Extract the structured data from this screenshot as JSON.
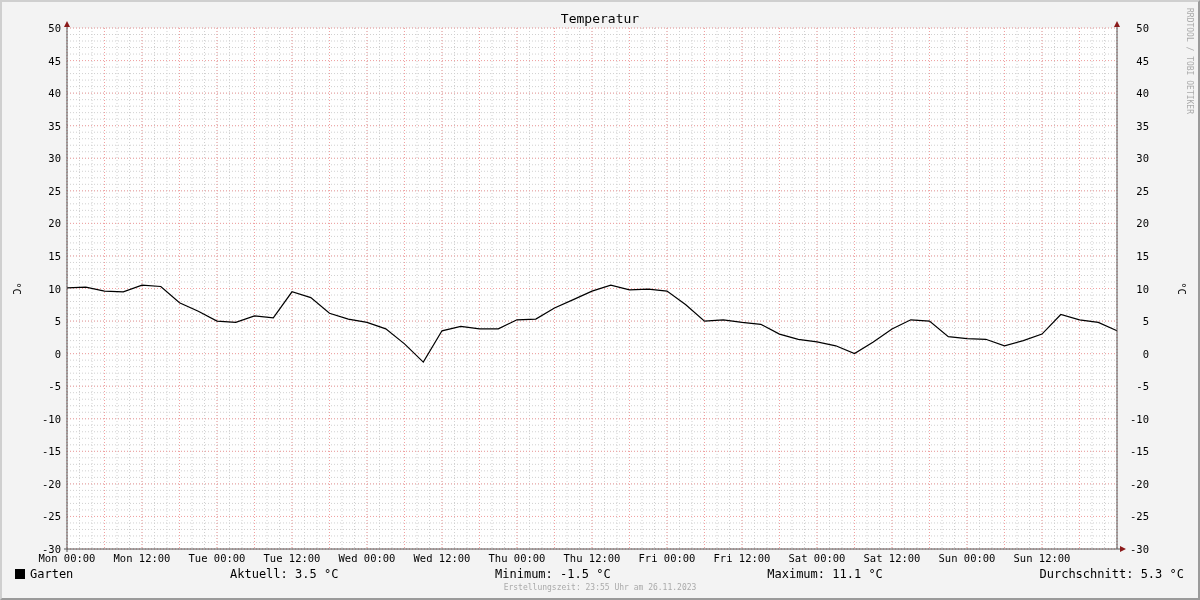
{
  "graph": {
    "watermark": "RRDTOOL / TOBI OETIKER",
    "right_ylabel": "°C",
    "right_yticks": [
      "50",
      "45",
      "40",
      "35",
      "30",
      "25",
      "20",
      "15",
      "10",
      "5",
      "0",
      "-5",
      "-10",
      "-15",
      "-20",
      "-25",
      "-30"
    ],
    "chart_data": {
      "type": "line",
      "title": "Temperatur",
      "ylabel": "°C",
      "categories": [
        "Mon 00:00",
        null,
        null,
        null,
        "Mon 12:00",
        null,
        null,
        null,
        "Tue 00:00",
        null,
        null,
        null,
        "Tue 12:00",
        null,
        null,
        null,
        "Wed 00:00",
        null,
        null,
        null,
        "Wed 12:00",
        null,
        null,
        null,
        "Thu 00:00",
        null,
        null,
        null,
        "Thu 12:00",
        null,
        null,
        null,
        "Fri 00:00",
        null,
        null,
        null,
        "Fri 12:00",
        null,
        null,
        null,
        "Sat 00:00",
        null,
        null,
        null,
        "Sat 12:00",
        null,
        null,
        null,
        "Sun 00:00",
        null,
        null,
        null,
        "Sun 12:00",
        null,
        null,
        null,
        null
      ],
      "series": [
        {
          "name": "Garten",
          "color": "#000000",
          "values": [
            10.1,
            10.2,
            9.6,
            9.5,
            10.5,
            10.3,
            7.8,
            6.5,
            5.0,
            4.8,
            5.8,
            5.5,
            9.5,
            8.6,
            6.2,
            5.3,
            4.8,
            3.8,
            1.5,
            -1.3,
            3.5,
            4.2,
            3.8,
            3.8,
            5.2,
            5.3,
            7.0,
            8.3,
            9.6,
            10.5,
            9.8,
            9.9,
            9.6,
            7.5,
            5.0,
            5.2,
            4.8,
            4.5,
            3.0,
            2.2,
            1.8,
            1.2,
            0.0,
            1.8,
            3.8,
            5.2,
            5.0,
            2.6,
            2.3,
            2.2,
            1.2,
            2.0,
            3.0,
            6.0,
            5.2,
            4.8,
            3.5
          ]
        }
      ],
      "ylim": [
        -30,
        50
      ],
      "grid": true,
      "yticks": [
        50,
        45,
        40,
        35,
        30,
        25,
        20,
        15,
        10,
        5,
        0,
        -5,
        -10,
        -15,
        -20,
        -25,
        -30
      ]
    }
  },
  "legend": {
    "stats": [
      "Aktuell: 3.5 °C",
      "Minimum: -1.5 °C",
      "Maximum: 11.1 °C",
      "Durchschnitt: 5.3 °C"
    ]
  },
  "footer": "Erstellungszeit: 23:55 Uhr am 26.11.2023"
}
